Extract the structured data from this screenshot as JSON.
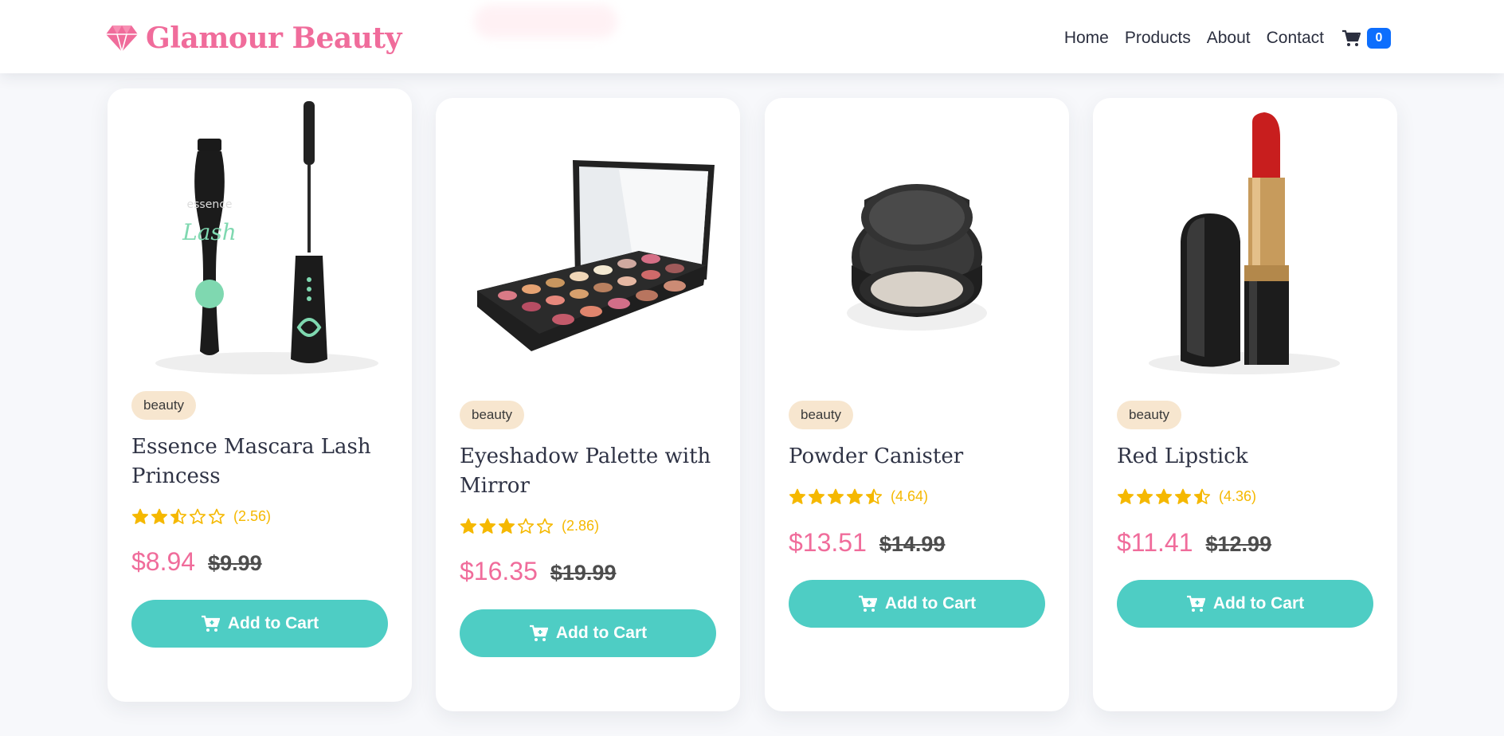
{
  "brand": {
    "name": "Glamour Beauty",
    "icon": "gem-icon",
    "color": "#f06c9b"
  },
  "nav": {
    "links": [
      "Home",
      "Products",
      "About",
      "Contact"
    ],
    "cart_icon": "cart-icon",
    "cart_count": "0"
  },
  "products": [
    {
      "category": "beauty",
      "title": "Essence Mascara Lash Princess",
      "rating": "(2.56)",
      "rating_value": 2.56,
      "price": "$8.94",
      "old_price": "$9.99",
      "button": "Add to Cart",
      "image": "mascara"
    },
    {
      "category": "beauty",
      "title": "Eyeshadow Palette with Mirror",
      "rating": "(2.86)",
      "rating_value": 2.86,
      "price": "$16.35",
      "old_price": "$19.99",
      "button": "Add to Cart",
      "image": "eyeshadow-palette"
    },
    {
      "category": "beauty",
      "title": "Powder Canister",
      "rating": "(4.64)",
      "rating_value": 4.64,
      "price": "$13.51",
      "old_price": "$14.99",
      "button": "Add to Cart",
      "image": "powder-canister"
    },
    {
      "category": "beauty",
      "title": "Red Lipstick",
      "rating": "(4.36)",
      "rating_value": 4.36,
      "price": "$11.41",
      "old_price": "$12.99",
      "button": "Add to Cart",
      "image": "red-lipstick"
    }
  ],
  "colors": {
    "accent": "#4ecdc4",
    "price": "#f06c9b",
    "star": "#f5b800",
    "badge_bg": "#f7e6cf",
    "cart_badge": "#0d6efd"
  }
}
